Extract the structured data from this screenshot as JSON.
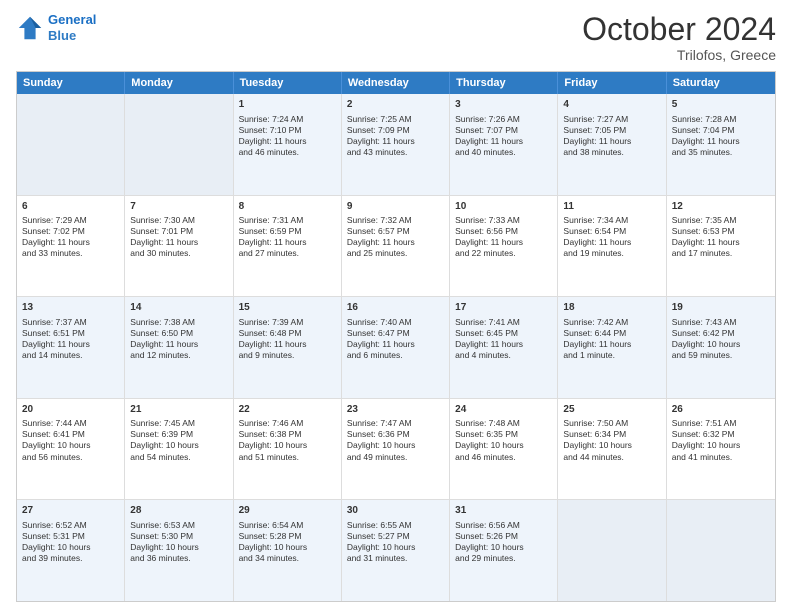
{
  "header": {
    "logo_line1": "General",
    "logo_line2": "Blue",
    "title": "October 2024",
    "location": "Trilofos, Greece"
  },
  "weekdays": [
    "Sunday",
    "Monday",
    "Tuesday",
    "Wednesday",
    "Thursday",
    "Friday",
    "Saturday"
  ],
  "rows": [
    [
      {
        "day": "",
        "lines": [],
        "empty": true
      },
      {
        "day": "",
        "lines": [],
        "empty": true
      },
      {
        "day": "1",
        "lines": [
          "Sunrise: 7:24 AM",
          "Sunset: 7:10 PM",
          "Daylight: 11 hours",
          "and 46 minutes."
        ],
        "empty": false
      },
      {
        "day": "2",
        "lines": [
          "Sunrise: 7:25 AM",
          "Sunset: 7:09 PM",
          "Daylight: 11 hours",
          "and 43 minutes."
        ],
        "empty": false
      },
      {
        "day": "3",
        "lines": [
          "Sunrise: 7:26 AM",
          "Sunset: 7:07 PM",
          "Daylight: 11 hours",
          "and 40 minutes."
        ],
        "empty": false
      },
      {
        "day": "4",
        "lines": [
          "Sunrise: 7:27 AM",
          "Sunset: 7:05 PM",
          "Daylight: 11 hours",
          "and 38 minutes."
        ],
        "empty": false
      },
      {
        "day": "5",
        "lines": [
          "Sunrise: 7:28 AM",
          "Sunset: 7:04 PM",
          "Daylight: 11 hours",
          "and 35 minutes."
        ],
        "empty": false
      }
    ],
    [
      {
        "day": "6",
        "lines": [
          "Sunrise: 7:29 AM",
          "Sunset: 7:02 PM",
          "Daylight: 11 hours",
          "and 33 minutes."
        ],
        "empty": false
      },
      {
        "day": "7",
        "lines": [
          "Sunrise: 7:30 AM",
          "Sunset: 7:01 PM",
          "Daylight: 11 hours",
          "and 30 minutes."
        ],
        "empty": false
      },
      {
        "day": "8",
        "lines": [
          "Sunrise: 7:31 AM",
          "Sunset: 6:59 PM",
          "Daylight: 11 hours",
          "and 27 minutes."
        ],
        "empty": false
      },
      {
        "day": "9",
        "lines": [
          "Sunrise: 7:32 AM",
          "Sunset: 6:57 PM",
          "Daylight: 11 hours",
          "and 25 minutes."
        ],
        "empty": false
      },
      {
        "day": "10",
        "lines": [
          "Sunrise: 7:33 AM",
          "Sunset: 6:56 PM",
          "Daylight: 11 hours",
          "and 22 minutes."
        ],
        "empty": false
      },
      {
        "day": "11",
        "lines": [
          "Sunrise: 7:34 AM",
          "Sunset: 6:54 PM",
          "Daylight: 11 hours",
          "and 19 minutes."
        ],
        "empty": false
      },
      {
        "day": "12",
        "lines": [
          "Sunrise: 7:35 AM",
          "Sunset: 6:53 PM",
          "Daylight: 11 hours",
          "and 17 minutes."
        ],
        "empty": false
      }
    ],
    [
      {
        "day": "13",
        "lines": [
          "Sunrise: 7:37 AM",
          "Sunset: 6:51 PM",
          "Daylight: 11 hours",
          "and 14 minutes."
        ],
        "empty": false
      },
      {
        "day": "14",
        "lines": [
          "Sunrise: 7:38 AM",
          "Sunset: 6:50 PM",
          "Daylight: 11 hours",
          "and 12 minutes."
        ],
        "empty": false
      },
      {
        "day": "15",
        "lines": [
          "Sunrise: 7:39 AM",
          "Sunset: 6:48 PM",
          "Daylight: 11 hours",
          "and 9 minutes."
        ],
        "empty": false
      },
      {
        "day": "16",
        "lines": [
          "Sunrise: 7:40 AM",
          "Sunset: 6:47 PM",
          "Daylight: 11 hours",
          "and 6 minutes."
        ],
        "empty": false
      },
      {
        "day": "17",
        "lines": [
          "Sunrise: 7:41 AM",
          "Sunset: 6:45 PM",
          "Daylight: 11 hours",
          "and 4 minutes."
        ],
        "empty": false
      },
      {
        "day": "18",
        "lines": [
          "Sunrise: 7:42 AM",
          "Sunset: 6:44 PM",
          "Daylight: 11 hours",
          "and 1 minute."
        ],
        "empty": false
      },
      {
        "day": "19",
        "lines": [
          "Sunrise: 7:43 AM",
          "Sunset: 6:42 PM",
          "Daylight: 10 hours",
          "and 59 minutes."
        ],
        "empty": false
      }
    ],
    [
      {
        "day": "20",
        "lines": [
          "Sunrise: 7:44 AM",
          "Sunset: 6:41 PM",
          "Daylight: 10 hours",
          "and 56 minutes."
        ],
        "empty": false
      },
      {
        "day": "21",
        "lines": [
          "Sunrise: 7:45 AM",
          "Sunset: 6:39 PM",
          "Daylight: 10 hours",
          "and 54 minutes."
        ],
        "empty": false
      },
      {
        "day": "22",
        "lines": [
          "Sunrise: 7:46 AM",
          "Sunset: 6:38 PM",
          "Daylight: 10 hours",
          "and 51 minutes."
        ],
        "empty": false
      },
      {
        "day": "23",
        "lines": [
          "Sunrise: 7:47 AM",
          "Sunset: 6:36 PM",
          "Daylight: 10 hours",
          "and 49 minutes."
        ],
        "empty": false
      },
      {
        "day": "24",
        "lines": [
          "Sunrise: 7:48 AM",
          "Sunset: 6:35 PM",
          "Daylight: 10 hours",
          "and 46 minutes."
        ],
        "empty": false
      },
      {
        "day": "25",
        "lines": [
          "Sunrise: 7:50 AM",
          "Sunset: 6:34 PM",
          "Daylight: 10 hours",
          "and 44 minutes."
        ],
        "empty": false
      },
      {
        "day": "26",
        "lines": [
          "Sunrise: 7:51 AM",
          "Sunset: 6:32 PM",
          "Daylight: 10 hours",
          "and 41 minutes."
        ],
        "empty": false
      }
    ],
    [
      {
        "day": "27",
        "lines": [
          "Sunrise: 6:52 AM",
          "Sunset: 5:31 PM",
          "Daylight: 10 hours",
          "and 39 minutes."
        ],
        "empty": false
      },
      {
        "day": "28",
        "lines": [
          "Sunrise: 6:53 AM",
          "Sunset: 5:30 PM",
          "Daylight: 10 hours",
          "and 36 minutes."
        ],
        "empty": false
      },
      {
        "day": "29",
        "lines": [
          "Sunrise: 6:54 AM",
          "Sunset: 5:28 PM",
          "Daylight: 10 hours",
          "and 34 minutes."
        ],
        "empty": false
      },
      {
        "day": "30",
        "lines": [
          "Sunrise: 6:55 AM",
          "Sunset: 5:27 PM",
          "Daylight: 10 hours",
          "and 31 minutes."
        ],
        "empty": false
      },
      {
        "day": "31",
        "lines": [
          "Sunrise: 6:56 AM",
          "Sunset: 5:26 PM",
          "Daylight: 10 hours",
          "and 29 minutes."
        ],
        "empty": false
      },
      {
        "day": "",
        "lines": [],
        "empty": true
      },
      {
        "day": "",
        "lines": [],
        "empty": true
      }
    ]
  ],
  "alt_rows": [
    0,
    2,
    4
  ]
}
